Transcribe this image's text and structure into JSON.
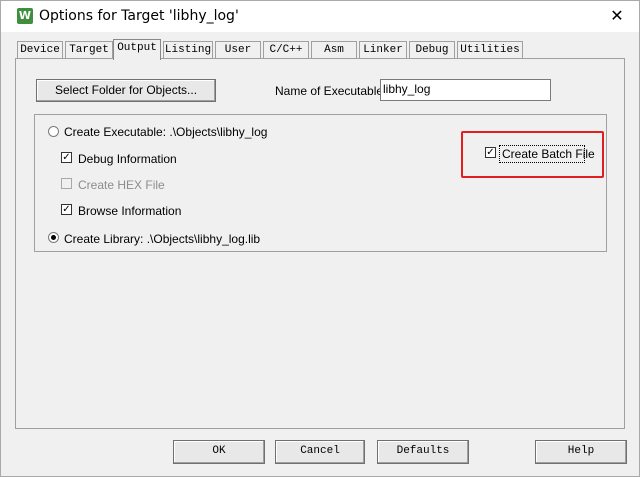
{
  "window": {
    "title": "Options for Target 'libhy_log'",
    "icon_label": "W",
    "close_symbol": "✕"
  },
  "tabs": [
    {
      "label": "Device"
    },
    {
      "label": "Target"
    },
    {
      "label": "Output",
      "active": true
    },
    {
      "label": "Listing"
    },
    {
      "label": "User"
    },
    {
      "label": "C/C++"
    },
    {
      "label": "Asm"
    },
    {
      "label": "Linker"
    },
    {
      "label": "Debug"
    },
    {
      "label": "Utilities"
    }
  ],
  "output": {
    "select_folder_button": "Select Folder for Objects...",
    "name_of_executable_label": "Name of Executable:",
    "name_of_executable_value": "libhy_log",
    "create_executable_label": "Create Executable:  .\\Objects\\libhy_log",
    "create_executable_selected": false,
    "debug_information_label": "Debug Information",
    "debug_information_checked": true,
    "create_hex_file_label": "Create HEX File",
    "create_hex_file_checked": false,
    "browse_information_label": "Browse Information",
    "browse_information_checked": true,
    "create_library_label": "Create Library:  .\\Objects\\libhy_log.lib",
    "create_library_selected": true,
    "create_batch_file_label": "Create Batch File",
    "create_batch_file_checked": true,
    "check_mark": "✓"
  },
  "footer": {
    "ok": "OK",
    "cancel": "Cancel",
    "defaults": "Defaults",
    "help": "Help"
  },
  "colors": {
    "highlight_border": "#e02020",
    "dialog_background": "#f0f0f0"
  }
}
